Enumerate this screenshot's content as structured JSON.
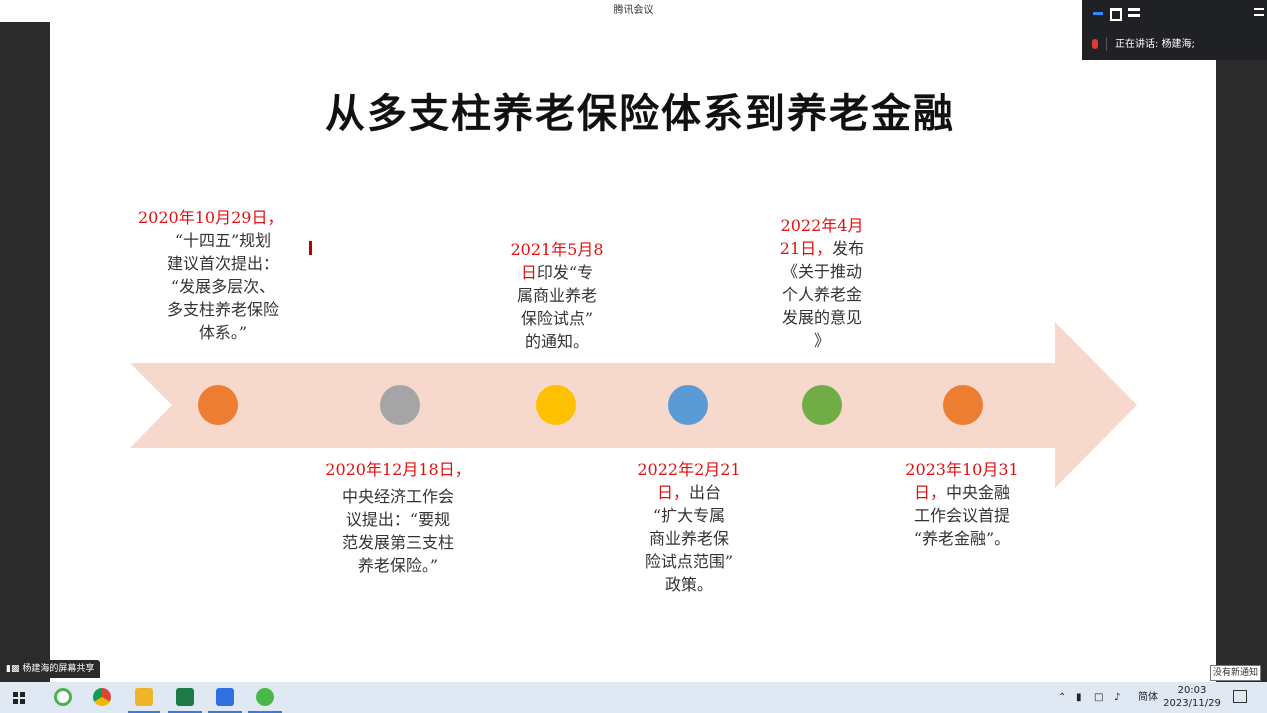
{
  "window": {
    "title": "腾讯会议"
  },
  "meeting_panel": {
    "speaking_label": "正在讲话:",
    "speaker_name": "杨建海;"
  },
  "slide": {
    "title": "从多支柱养老保险体系到养老金融",
    "arrow_color": "#f6d8cc",
    "dots": [
      {
        "color": "#ed7d31"
      },
      {
        "color": "#a5a5a5"
      },
      {
        "color": "#ffc000"
      },
      {
        "color": "#5b9bd5"
      },
      {
        "color": "#70ad47"
      },
      {
        "color": "#ed7d31"
      }
    ],
    "milestones": [
      {
        "date": "2020年10月29日，",
        "lines": [
          "“十四五”规划",
          "建议首次提出：",
          "“发展多层次、",
          "多支柱养老保险",
          "体系。”"
        ]
      },
      {
        "date": "2020年12月18日，",
        "lines": [
          "中央经济工作会",
          "议提出：“要规",
          "范发展第三支柱",
          "养老保险。”"
        ]
      },
      {
        "date": "2021年5月8",
        "date2": "日",
        "first_rest": "印发“专",
        "lines": [
          "属商业养老",
          "保险试点”",
          "的通知。"
        ]
      },
      {
        "date": "2022年2月21",
        "date2": "日，",
        "first_rest": "出台",
        "lines": [
          "“扩大专属",
          "商业养老保",
          "险试点范围”",
          "政策。"
        ]
      },
      {
        "date": "2022年4月",
        "date2": "21日，",
        "first_rest": "发布",
        "lines": [
          "《关于推动",
          "个人养老金",
          "发展的意见",
          "》"
        ]
      },
      {
        "date": "2023年10月31",
        "date2": "日，",
        "first_rest": "中央金融",
        "lines": [
          "工作会议首提",
          "“养老金融”。"
        ]
      }
    ]
  },
  "share_bar": {
    "label": "杨建海的屏幕共享"
  },
  "notification": {
    "label": "没有新通知"
  },
  "taskbar": {
    "ime": "简体",
    "time": "20:03",
    "date": "2023/11/29"
  }
}
